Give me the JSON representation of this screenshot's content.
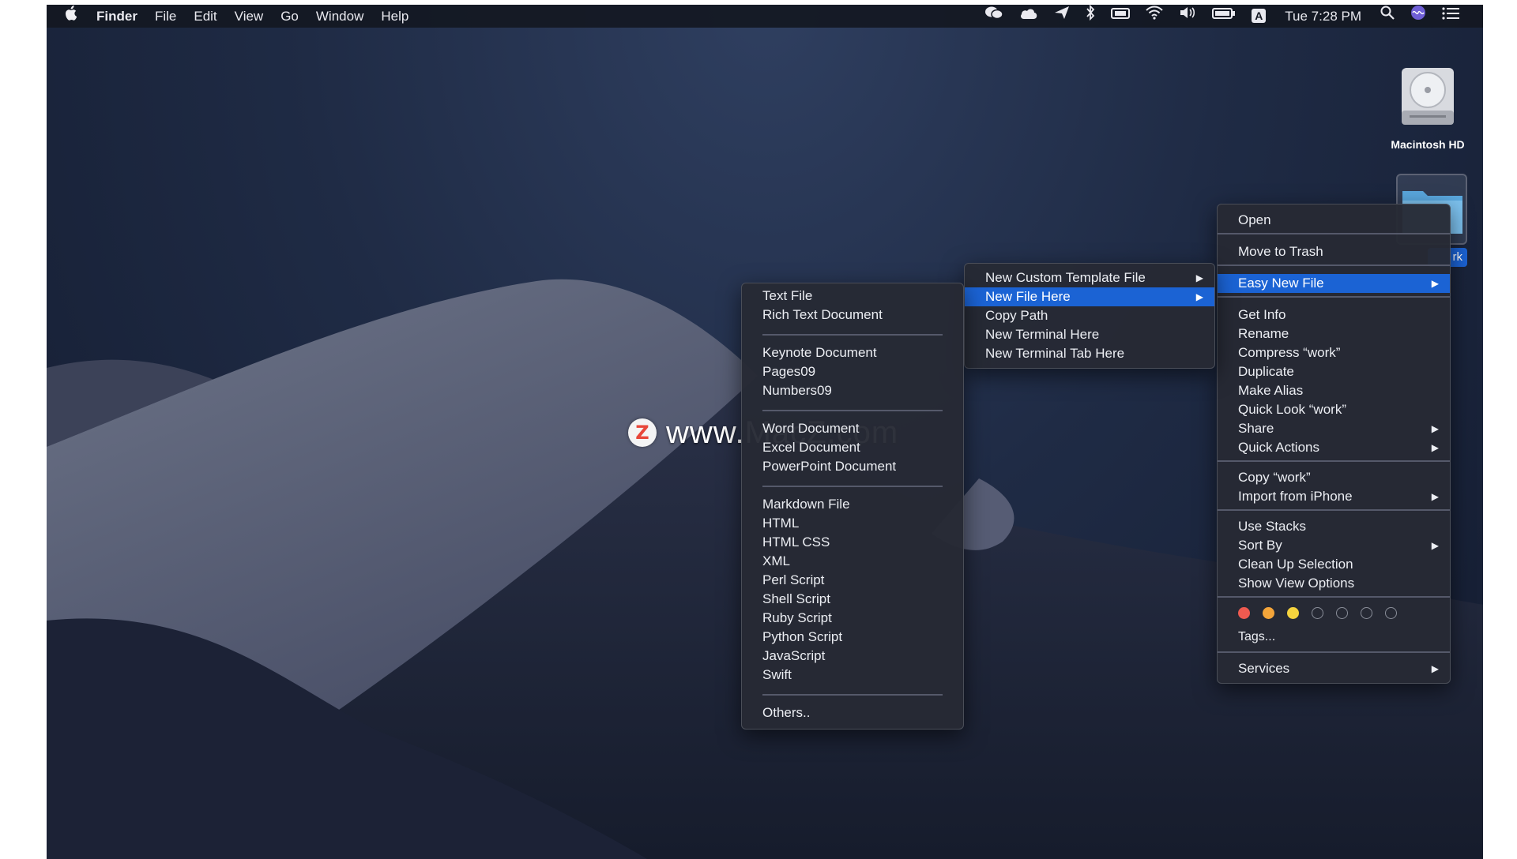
{
  "menubar": {
    "apple_icon": "apple-icon",
    "app_name": "Finder",
    "menus": [
      "File",
      "Edit",
      "View",
      "Go",
      "Window",
      "Help"
    ],
    "clock": "Tue 7:28 PM",
    "input_indicator": "A"
  },
  "desktop": {
    "drive_label": "Macintosh HD",
    "folder_label_fragment": "rk"
  },
  "context_menu": {
    "items": {
      "open": "Open",
      "trash": "Move to Trash",
      "easy_new_file": "Easy New File",
      "get_info": "Get Info",
      "rename": "Rename",
      "compress": "Compress “work”",
      "duplicate": "Duplicate",
      "make_alias": "Make Alias",
      "quick_look": "Quick Look “work”",
      "share": "Share",
      "quick_actions": "Quick Actions",
      "copy": "Copy “work”",
      "import_iphone": "Import from iPhone",
      "use_stacks": "Use Stacks",
      "sort_by": "Sort By",
      "clean_up": "Clean Up Selection",
      "view_options": "Show View Options",
      "tags": "Tags...",
      "services": "Services"
    },
    "tag_colors": [
      "#ef5a50",
      "#f4a53a",
      "#f5d33e",
      "",
      "",
      "",
      ""
    ],
    "submenu_arrow": "▶"
  },
  "easy_new_file_menu": {
    "items": [
      "New Custom Template File",
      "New File Here",
      "Copy Path",
      "New Terminal Here",
      "New Terminal Tab Here"
    ]
  },
  "new_file_menu": {
    "group1": [
      "Text File",
      "Rich Text Document"
    ],
    "group2": [
      "Keynote Document",
      "Pages09",
      "Numbers09"
    ],
    "group3": [
      "Word Document",
      "Excel Document",
      "PowerPoint Document"
    ],
    "group4": [
      "Markdown File",
      "HTML",
      "HTML CSS",
      "XML",
      "Perl Script",
      "Shell Script",
      "Ruby Script",
      "Python Script",
      "JavaScript",
      "Swift"
    ],
    "group5": [
      "Others.."
    ]
  },
  "watermark": {
    "badge": "Z",
    "text": "www.MacZ.com"
  },
  "colors": {
    "selection": "#1b63d4",
    "menu_bg": "#262a34",
    "menubar_bg": "#141822"
  }
}
